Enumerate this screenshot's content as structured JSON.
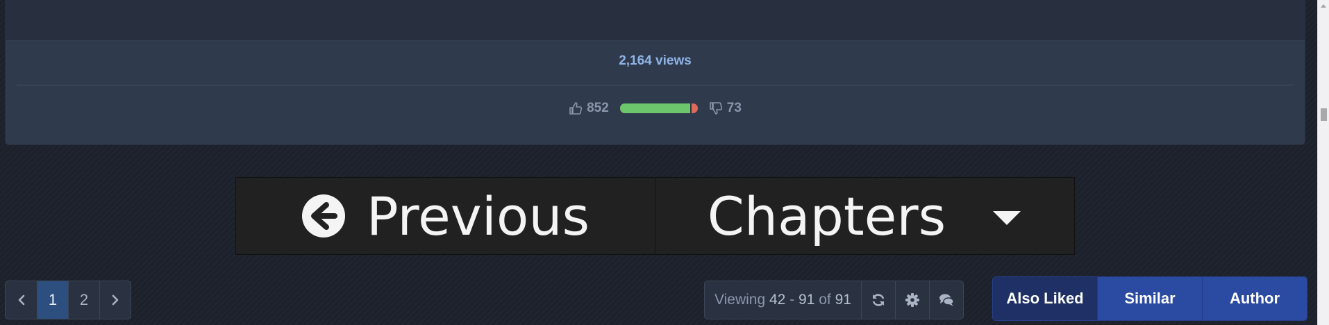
{
  "card": {
    "views_text": "2,164 views",
    "likes": "852",
    "dislikes": "73",
    "like_ratio": 0.921
  },
  "chapter_nav": {
    "previous_label": "Previous",
    "chapters_label": "Chapters"
  },
  "pagination": {
    "pages": [
      "1",
      "2"
    ],
    "current_page": "1"
  },
  "viewing": {
    "prefix": "Viewing ",
    "range_start": "42",
    "range_sep": " - ",
    "range_end": "91",
    "of": " of ",
    "total": "91"
  },
  "tabs": [
    {
      "label": "Also Liked",
      "active": true
    },
    {
      "label": "Similar",
      "active": false
    },
    {
      "label": "Author",
      "active": false
    }
  ],
  "colors": {
    "like_bar": "#6cc66c",
    "dislike_bar": "#e06a5a",
    "active_page": "#2c4f80",
    "tab_bg": "#2b4ba2",
    "tab_active_bg": "#1e3066"
  },
  "icons": [
    "thumbs-up-icon",
    "thumbs-down-icon",
    "circle-arrow-left-icon",
    "caret-down-icon",
    "chevron-left-icon",
    "chevron-right-icon",
    "refresh-icon",
    "gear-icon",
    "comments-icon"
  ]
}
